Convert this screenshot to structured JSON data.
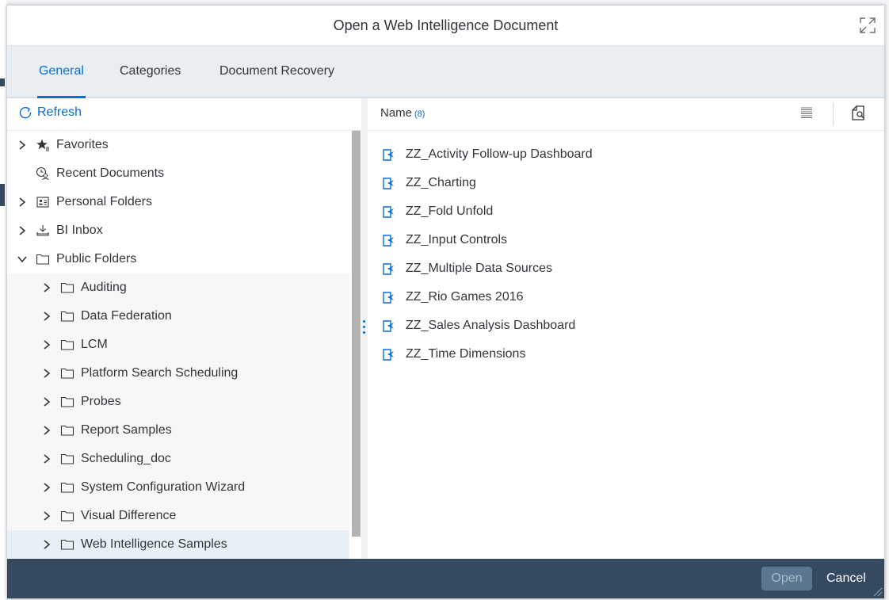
{
  "dialog": {
    "title": "Open a Web Intelligence Document"
  },
  "tabs": [
    {
      "label": "General",
      "active": true
    },
    {
      "label": "Categories",
      "active": false
    },
    {
      "label": "Document Recovery",
      "active": false
    }
  ],
  "left": {
    "refresh_label": "Refresh",
    "tree": [
      {
        "label": "Favorites",
        "icon": "favorites-icon",
        "expanded": false
      },
      {
        "label": "Recent Documents",
        "icon": "recent-icon",
        "expanded": null
      },
      {
        "label": "Personal Folders",
        "icon": "personal-folder-icon",
        "expanded": false
      },
      {
        "label": "BI Inbox",
        "icon": "inbox-icon",
        "expanded": false
      },
      {
        "label": "Public Folders",
        "icon": "folder-icon",
        "expanded": true
      },
      {
        "label": "Auditing",
        "icon": "folder-icon",
        "expanded": false
      },
      {
        "label": "Data Federation",
        "icon": "folder-icon",
        "expanded": false
      },
      {
        "label": "LCM",
        "icon": "folder-icon",
        "expanded": false
      },
      {
        "label": "Platform Search Scheduling",
        "icon": "folder-icon",
        "expanded": false
      },
      {
        "label": "Probes",
        "icon": "folder-icon",
        "expanded": false
      },
      {
        "label": "Report Samples",
        "icon": "folder-icon",
        "expanded": false
      },
      {
        "label": "Scheduling_doc",
        "icon": "folder-icon",
        "expanded": false
      },
      {
        "label": "System Configuration Wizard",
        "icon": "folder-icon",
        "expanded": false
      },
      {
        "label": "Visual Difference",
        "icon": "folder-icon",
        "expanded": false
      },
      {
        "label": "Web Intelligence Samples",
        "icon": "folder-icon",
        "expanded": false,
        "selected": true
      }
    ]
  },
  "right": {
    "column_label": "Name",
    "count": "(8)",
    "documents": [
      "ZZ_Activity Follow-up Dashboard",
      "ZZ_Charting",
      "ZZ_Fold Unfold",
      "ZZ_Input Controls",
      "ZZ_Multiple Data Sources",
      "ZZ_Rio Games 2016",
      "ZZ_Sales Analysis Dashboard",
      "ZZ_Time Dimensions"
    ]
  },
  "footer": {
    "open_label": "Open",
    "cancel_label": "Cancel"
  },
  "colors": {
    "accent": "#0a6ed1",
    "footer": "#354a5f",
    "tabbar": "#e9eef2"
  }
}
